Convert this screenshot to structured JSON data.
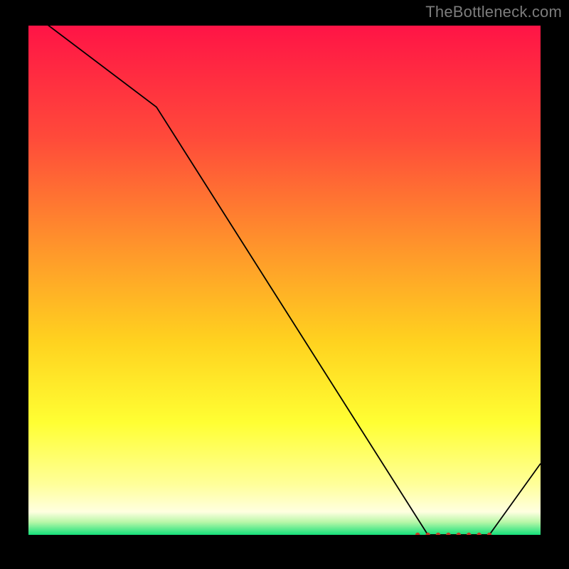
{
  "watermark": "TheBottleneck.com",
  "chart_data": {
    "type": "line",
    "title": "",
    "xlabel": "",
    "ylabel": "",
    "xlim": [
      0,
      100
    ],
    "ylim": [
      0,
      100
    ],
    "x": [
      0,
      25,
      78,
      90,
      100
    ],
    "values": [
      103,
      84,
      0,
      0,
      14
    ],
    "marker_band": {
      "x_start": 76,
      "x_end": 90,
      "y": 0,
      "count": 8
    },
    "gradient_stops": [
      {
        "offset": 0.0,
        "color": "#ff1446"
      },
      {
        "offset": 0.22,
        "color": "#ff4a3a"
      },
      {
        "offset": 0.45,
        "color": "#ff9a2a"
      },
      {
        "offset": 0.62,
        "color": "#ffd21f"
      },
      {
        "offset": 0.78,
        "color": "#ffff33"
      },
      {
        "offset": 0.9,
        "color": "#ffff99"
      },
      {
        "offset": 0.955,
        "color": "#ffffe0"
      },
      {
        "offset": 0.975,
        "color": "#b8f7a8"
      },
      {
        "offset": 1.0,
        "color": "#14e07a"
      }
    ]
  }
}
